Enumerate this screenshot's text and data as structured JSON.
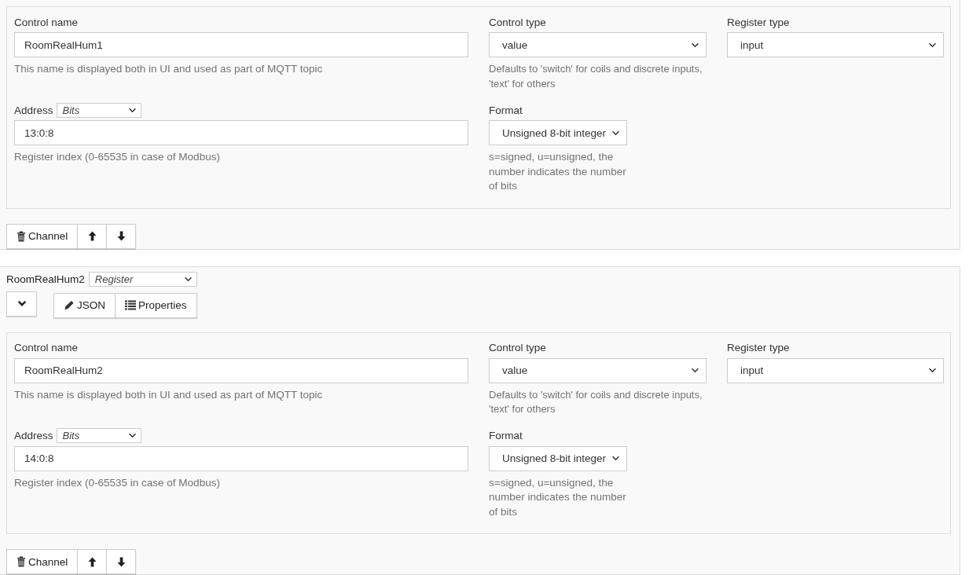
{
  "channels": [
    {
      "form": {
        "control_name": {
          "label": "Control name",
          "value": "RoomRealHum1",
          "help": "This name is displayed both in UI and used as part of MQTT topic"
        },
        "control_type": {
          "label": "Control type",
          "value": "value",
          "help": "Defaults to 'switch' for coils and discrete inputs, 'text' for others"
        },
        "register_type": {
          "label": "Register type",
          "value": "input"
        },
        "address": {
          "label": "Address",
          "mode": "Bits",
          "value": "13:0:8",
          "help": "Register index (0-65535 in case of Modbus)"
        },
        "format": {
          "label": "Format",
          "value": "Unsigned 8-bit integer",
          "help": "s=signed, u=unsigned, the number indicates the number of bits"
        }
      },
      "actions": {
        "delete_label": "Channel"
      }
    },
    {
      "header": {
        "name": "RoomRealHum2",
        "type": "Register",
        "buttons": [
          "JSON",
          "Properties"
        ]
      },
      "form": {
        "control_name": {
          "label": "Control name",
          "value": "RoomRealHum2",
          "help": "This name is displayed both in UI and used as part of MQTT topic"
        },
        "control_type": {
          "label": "Control type",
          "value": "value",
          "help": "Defaults to 'switch' for coils and discrete inputs, 'text' for others"
        },
        "register_type": {
          "label": "Register type",
          "value": "input"
        },
        "address": {
          "label": "Address",
          "mode": "Bits",
          "value": "14:0:8",
          "help": "Register index (0-65535 in case of Modbus)"
        },
        "format": {
          "label": "Format",
          "value": "Unsigned 8-bit integer",
          "help": "s=signed, u=unsigned, the number indicates the number of bits"
        }
      },
      "actions": {
        "delete_label": "Channel"
      }
    }
  ]
}
